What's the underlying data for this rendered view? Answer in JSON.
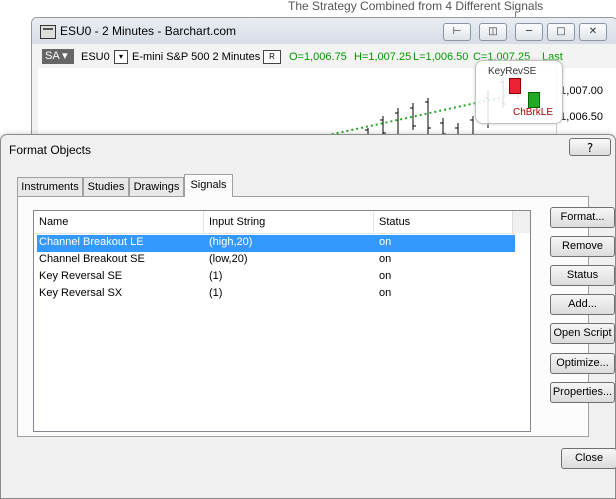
{
  "caption": "The Strategy Combined from 4 Different Signals",
  "chart_window": {
    "title": "ESU0 - 2 Minutes - Barchart.com",
    "sa_label": "SA",
    "symbol": "ESU0",
    "instrument": "E-mini S&P 500  2 Minutes",
    "r_label": "R",
    "open": "O=1,006.75",
    "high": "H=1,007.25",
    "low": "L=1,006.50",
    "close": "C=1,007.25",
    "close_suffix": "Last",
    "price_labels": [
      "1,007.00",
      "1,006.50"
    ],
    "callout_top": "KeyRevSE",
    "callout_bottom": "ChBrkLE",
    "colors": {
      "ohlc": "#009900",
      "sell_arrow": "#ee2233",
      "buy_arrow": "#22aa22",
      "trendline": "#22aa22"
    }
  },
  "dialog": {
    "title": "Format Objects",
    "help_label": "?",
    "tabs": [
      "Instruments",
      "Studies",
      "Drawings",
      "Signals"
    ],
    "active_tab": "Signals",
    "columns": [
      "Name",
      "Input String",
      "Status"
    ],
    "rows": [
      {
        "name": "Channel Breakout LE",
        "input": "(high,20)",
        "status": "on",
        "selected": true
      },
      {
        "name": "Channel Breakout SE",
        "input": "(low,20)",
        "status": "on",
        "selected": false
      },
      {
        "name": "Key Reversal SE",
        "input": "(1)",
        "status": "on",
        "selected": false
      },
      {
        "name": "Key Reversal SX",
        "input": "(1)",
        "status": "on",
        "selected": false
      }
    ],
    "buttons": [
      "Format...",
      "Remove",
      "Status",
      "Add...",
      "Open Script",
      "Optimize...",
      "Properties..."
    ],
    "close_label": "Close",
    "colors": {
      "selection": "#3399ff"
    }
  }
}
